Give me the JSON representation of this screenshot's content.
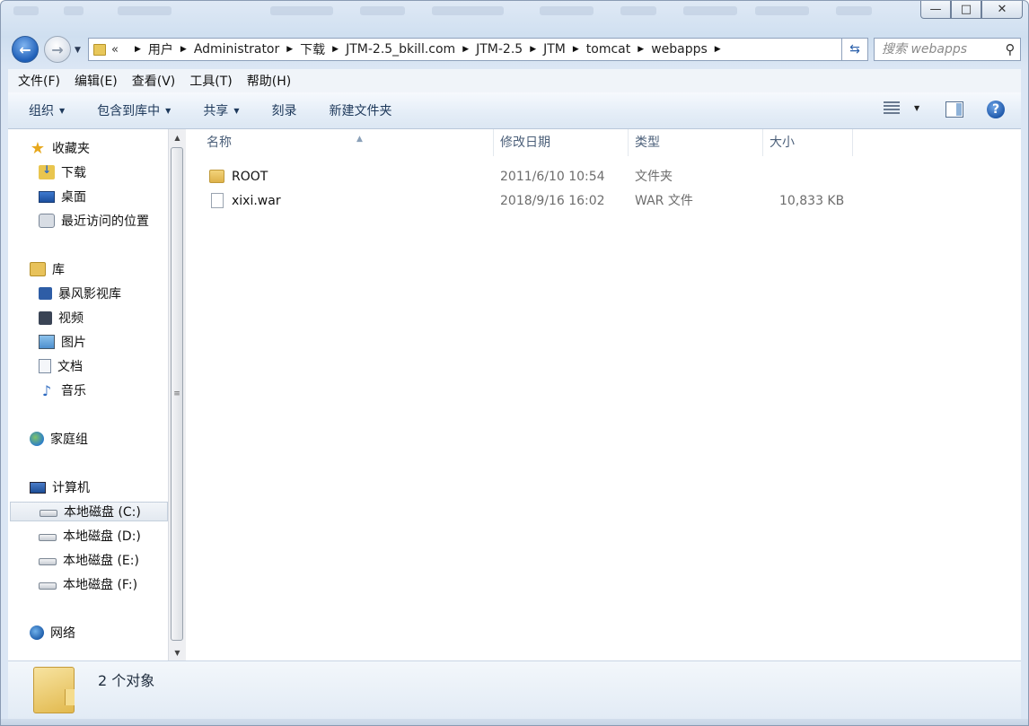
{
  "window": {
    "caption_buttons": {
      "minimize": "—",
      "maximize": "□",
      "close": "✕"
    }
  },
  "nav": {
    "back_icon": "back-arrow-icon",
    "forward_icon": "forward-arrow-icon",
    "overflow": "«",
    "breadcrumb": [
      "用户",
      "Administrator",
      "下载",
      "JTM-2.5_bkill.com",
      "JTM-2.5",
      "JTM",
      "tomcat",
      "webapps"
    ]
  },
  "search": {
    "placeholder": "搜索 webapps"
  },
  "menubar": {
    "items": [
      "文件(F)",
      "编辑(E)",
      "查看(V)",
      "工具(T)",
      "帮助(H)"
    ]
  },
  "toolbar": {
    "organize": "组织",
    "include_in_library": "包含到库中",
    "share": "共享",
    "burn": "刻录",
    "new_folder": "新建文件夹",
    "help": "?"
  },
  "navpane": {
    "favorites": {
      "label": "收藏夹",
      "items": [
        "下载",
        "桌面",
        "最近访问的位置"
      ]
    },
    "libraries": {
      "label": "库",
      "items": [
        "暴风影视库",
        "视频",
        "图片",
        "文档",
        "音乐"
      ]
    },
    "homegroup": "家庭组",
    "computer": {
      "label": "计算机",
      "items": [
        "本地磁盘 (C:)",
        "本地磁盘 (D:)",
        "本地磁盘 (E:)",
        "本地磁盘 (F:)"
      ],
      "selected": "本地磁盘 (C:)"
    },
    "network": "网络"
  },
  "list": {
    "columns": [
      "名称",
      "修改日期",
      "类型",
      "大小"
    ],
    "rows": [
      {
        "name": "ROOT",
        "date": "2011/6/10 10:54",
        "type": "文件夹",
        "size": ""
      },
      {
        "name": "xixi.war",
        "date": "2018/9/16 16:02",
        "type": "WAR 文件",
        "size": "10,833 KB"
      }
    ]
  },
  "details": {
    "count": "2 个对象"
  },
  "colors": {
    "accent": "#1f5fb8",
    "toolbar_text": "#1e395b",
    "header_text": "#4c607a",
    "detail_text": "#6d6d6d"
  }
}
